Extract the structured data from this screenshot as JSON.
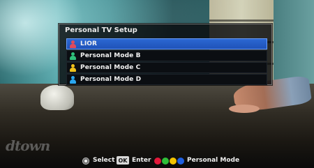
{
  "dialog": {
    "title": "Personal TV Setup",
    "items": [
      {
        "label": "LIOR",
        "icon": "person-icon",
        "color": "#e04a5c",
        "selected": true
      },
      {
        "label": "Personal Mode B",
        "icon": "person-icon",
        "color": "#2fc07a",
        "selected": false
      },
      {
        "label": "Personal Mode C",
        "icon": "person-icon",
        "color": "#f1c21b",
        "selected": false
      },
      {
        "label": "Personal Mode D",
        "icon": "person-icon",
        "color": "#2aa7f0",
        "selected": false
      }
    ]
  },
  "footer": {
    "select_icon": "dpad-icon",
    "select_label": "Select",
    "ok_key": "OK",
    "enter_label": "Enter",
    "color_buttons": [
      "#e2183a",
      "#2fbf3a",
      "#f3c300",
      "#1f5fe0"
    ],
    "personal_mode_label": "Personal Mode"
  },
  "watermark": "dtown"
}
